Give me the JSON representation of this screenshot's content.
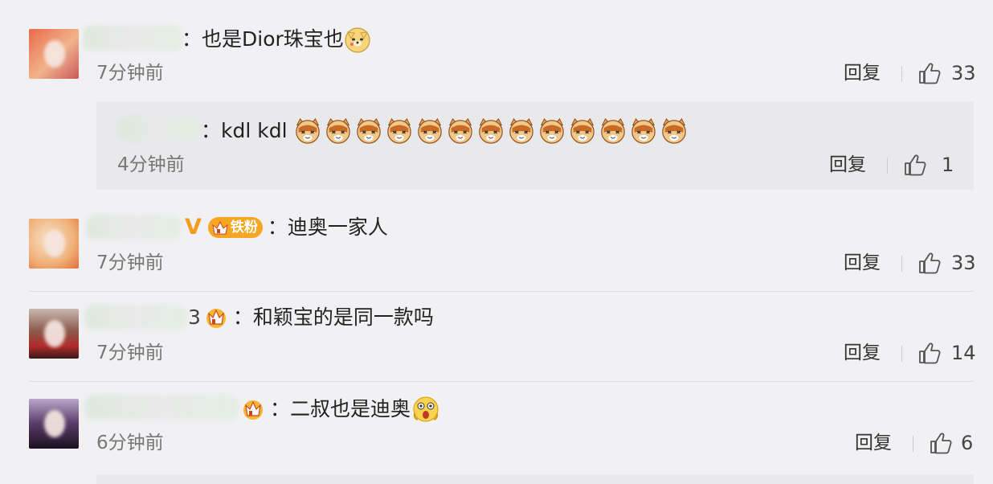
{
  "comments": [
    {
      "text": "：也是Dior珠宝也",
      "time": "7分钟前",
      "reply_label": "回复",
      "likes": "33"
    },
    {
      "text": "：kdl kdl",
      "time": "4分钟前",
      "reply_label": "回复",
      "likes": "1",
      "is_reply": true
    },
    {
      "name_suffix": "V",
      "fan_badge": "铁粉",
      "text": "：迪奥一家人",
      "time": "7分钟前",
      "reply_label": "回复",
      "likes": "33"
    },
    {
      "name_suffix": "3",
      "text": "：和颖宝的是同一款吗",
      "time": "7分钟前",
      "reply_label": "回复",
      "likes": "14"
    },
    {
      "text": "：二叔也是迪奥",
      "time": "6分钟前",
      "reply_label": "回复",
      "likes": "6"
    }
  ],
  "colors": {
    "background": "#f1f0f3",
    "reply_box": "#e9e8eb",
    "vip_orange": "#f39c1f",
    "fan_badge": "#f5a623"
  },
  "icons": [
    "thumbs-up-icon",
    "doge-emoji-icon",
    "cat-emoji-icon",
    "shocked-emoji-icon",
    "crown-badge-icon",
    "verified-v-icon"
  ]
}
